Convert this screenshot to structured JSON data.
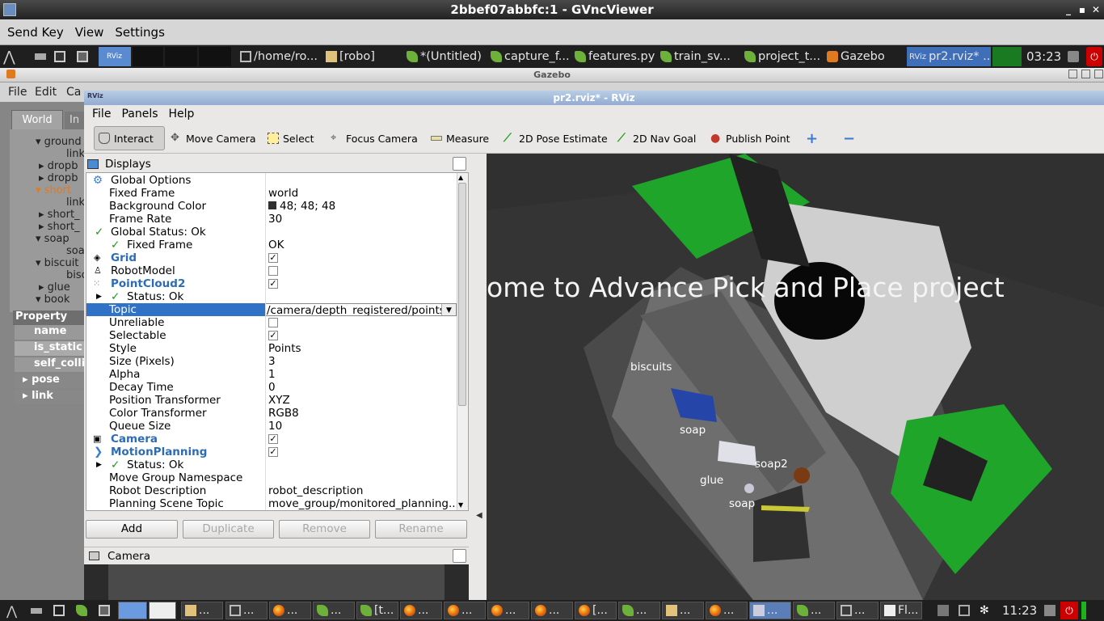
{
  "vnc": {
    "title": "2bbef07abbfc:1 - GVncViewer",
    "minimize": "_",
    "maximize": "▪",
    "close": "✕",
    "menu": [
      "Send Key",
      "View",
      "Settings"
    ]
  },
  "top_panel": {
    "tasks": [
      "/home/ro...",
      "[robo]",
      "*(Untitled)",
      "capture_f...",
      "features.py",
      "train_sv...",
      "project_t...",
      "Gazebo",
      "pr2.rviz* ..."
    ],
    "clock": "03:23"
  },
  "gazebo": {
    "title": "Gazebo",
    "menu": [
      "File",
      "Edit",
      "Ca"
    ],
    "tabs": [
      "World",
      "In"
    ],
    "tree": [
      "ground",
      "link",
      "dropb",
      "dropb",
      "short",
      "link",
      "short_",
      "short_",
      "soap",
      "soa",
      "biscuit",
      "bisc",
      "glue",
      "book"
    ],
    "property_header": "Property",
    "properties": [
      "name",
      "is_static",
      "self_colli",
      "pose",
      "link"
    ]
  },
  "rviz": {
    "title": "pr2.rviz* - RViz",
    "menu": [
      "File",
      "Panels",
      "Help"
    ],
    "tools": [
      "Interact",
      "Move Camera",
      "Select",
      "Focus Camera",
      "Measure",
      "2D Pose Estimate",
      "2D Nav Goal",
      "Publish Point"
    ],
    "displays_title": "Displays",
    "rows": [
      {
        "label": "Global Options",
        "value": ""
      },
      {
        "label": "Fixed Frame",
        "value": "world"
      },
      {
        "label": "Background Color",
        "value": "48; 48; 48"
      },
      {
        "label": "Frame Rate",
        "value": "30"
      },
      {
        "label": "Global Status: Ok",
        "value": ""
      },
      {
        "label": "Fixed Frame",
        "value": "OK"
      },
      {
        "label": "Grid",
        "value": ""
      },
      {
        "label": "RobotModel",
        "value": ""
      },
      {
        "label": "PointCloud2",
        "value": ""
      },
      {
        "label": "Status: Ok",
        "value": ""
      },
      {
        "label": "Topic",
        "value": "/camera/depth_registered/points"
      },
      {
        "label": "Unreliable",
        "value": ""
      },
      {
        "label": "Selectable",
        "value": ""
      },
      {
        "label": "Style",
        "value": "Points"
      },
      {
        "label": "Size (Pixels)",
        "value": "3"
      },
      {
        "label": "Alpha",
        "value": "1"
      },
      {
        "label": "Decay Time",
        "value": "0"
      },
      {
        "label": "Position Transformer",
        "value": "XYZ"
      },
      {
        "label": "Color Transformer",
        "value": "RGB8"
      },
      {
        "label": "Queue Size",
        "value": "10"
      },
      {
        "label": "Camera",
        "value": ""
      },
      {
        "label": "MotionPlanning",
        "value": ""
      },
      {
        "label": "Status: Ok",
        "value": ""
      },
      {
        "label": "Move Group Namespace",
        "value": ""
      },
      {
        "label": "Robot Description",
        "value": "robot_description"
      },
      {
        "label": "Planning Scene Topic",
        "value": "move_group/monitored_planning..."
      }
    ],
    "buttons": [
      "Add",
      "Duplicate",
      "Remove",
      "Rename"
    ],
    "camera_title": "Camera",
    "view_banner": "ome  to  Advance  Pick  and  Place  project",
    "view_labels": [
      "biscuits",
      "soap",
      "soap2",
      "glue",
      "soap"
    ]
  },
  "bottom_panel": {
    "tasks": [
      "...",
      "...",
      "...",
      "...",
      "[t...",
      "...",
      "...",
      "...",
      "...",
      "[...",
      "...",
      "...",
      "...",
      "...",
      "...",
      "...",
      "Fl..."
    ],
    "clock": "11:23"
  }
}
